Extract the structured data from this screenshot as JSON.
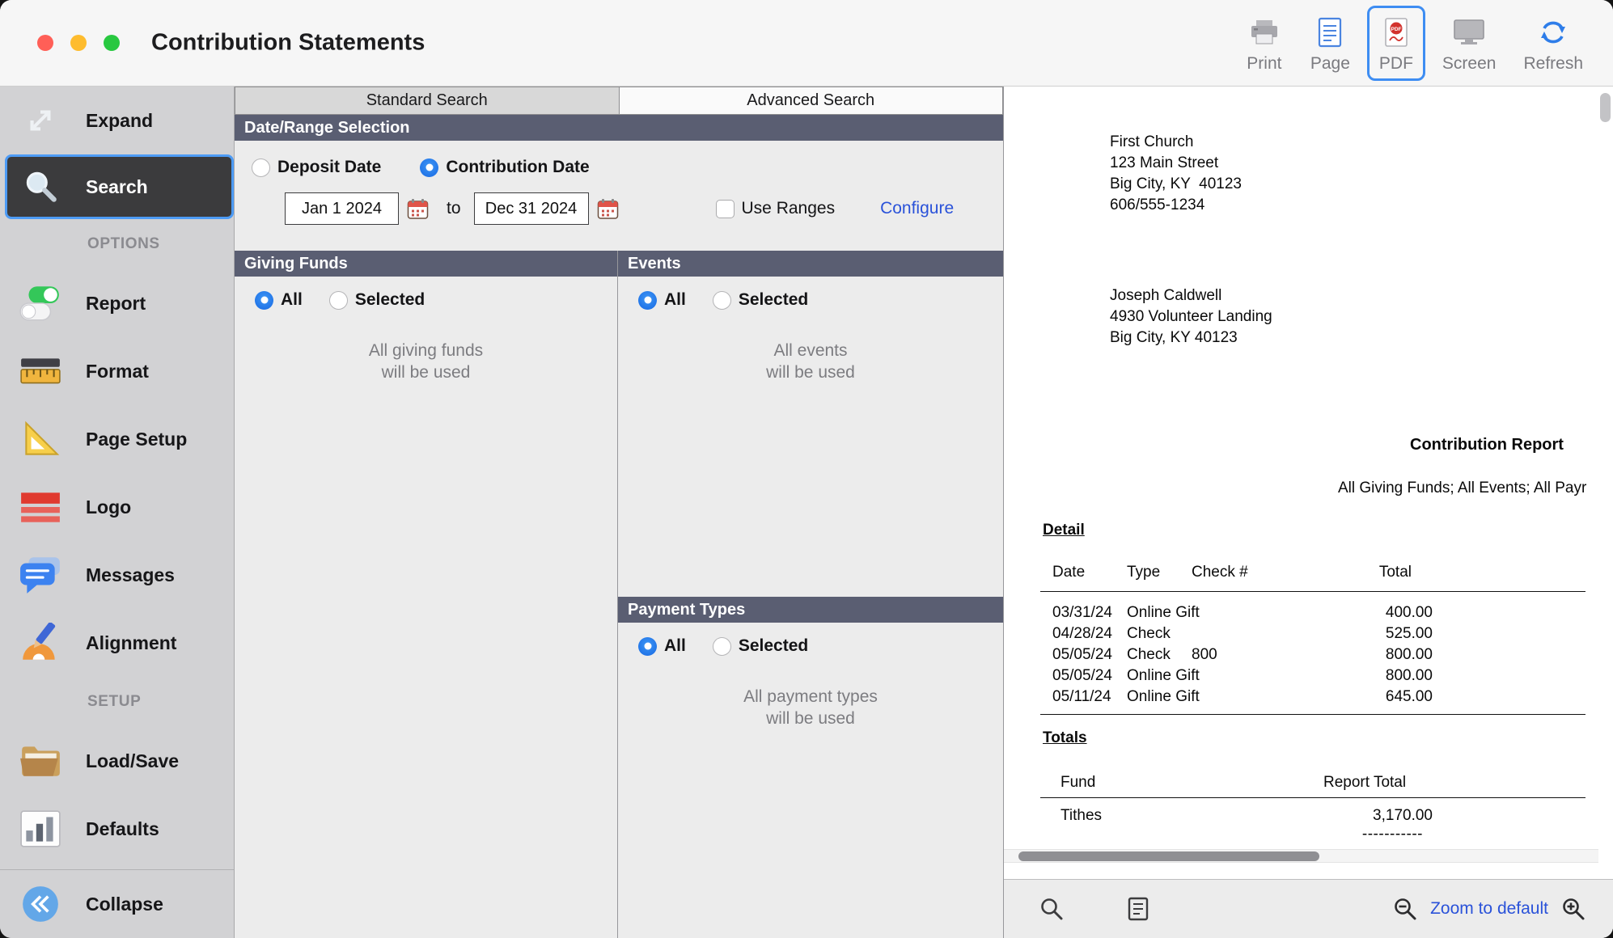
{
  "window": {
    "title": "Contribution Statements"
  },
  "toolbar": {
    "print": "Print",
    "page": "Page",
    "pdf": "PDF",
    "screen": "Screen",
    "refresh": "Refresh"
  },
  "sidebar": {
    "expand": "Expand",
    "search": "Search",
    "options_header": "OPTIONS",
    "report": "Report",
    "format": "Format",
    "page_setup": "Page Setup",
    "logo": "Logo",
    "messages": "Messages",
    "alignment": "Alignment",
    "setup_header": "SETUP",
    "load_save": "Load/Save",
    "defaults": "Defaults",
    "collapse": "Collapse"
  },
  "tabs": {
    "standard": "Standard Search",
    "advanced": "Advanced Search"
  },
  "date_range": {
    "header": "Date/Range Selection",
    "deposit_date": "Deposit Date",
    "contribution_date": "Contribution Date",
    "from_date": "Jan 1 2024",
    "to": "to",
    "to_date": "Dec 31 2024",
    "use_ranges": "Use Ranges",
    "configure": "Configure"
  },
  "giving_funds": {
    "header": "Giving Funds",
    "all": "All",
    "selected": "Selected",
    "note1": "All giving funds",
    "note2": "will be used"
  },
  "events": {
    "header": "Events",
    "all": "All",
    "selected": "Selected",
    "note1": "All events",
    "note2": "will be used"
  },
  "payment_types": {
    "header": "Payment Types",
    "all": "All",
    "selected": "Selected",
    "note1": "All payment types",
    "note2": "will be used"
  },
  "preview": {
    "church_name": "First Church",
    "church_street": "123 Main Street",
    "church_city": "Big City, KY  40123",
    "church_phone": "606/555-1234",
    "recipient_name": "Joseph Caldwell",
    "recipient_street": "4930 Volunteer Landing",
    "recipient_city": "Big City, KY 40123",
    "report_title": "Contribution Report",
    "report_subtitle": "All Giving Funds; All Events; All Payr",
    "detail_label": "Detail",
    "detail_columns": {
      "date": "Date",
      "type": "Type",
      "check": "Check #",
      "total": "Total"
    },
    "detail_rows": [
      {
        "date": "03/31/24",
        "type": "Online Gift",
        "check": "",
        "total": "400.00"
      },
      {
        "date": "04/28/24",
        "type": "Check",
        "check": "",
        "total": "525.00"
      },
      {
        "date": "05/05/24",
        "type": "Check",
        "check": "800",
        "total": "800.00"
      },
      {
        "date": "05/05/24",
        "type": "Online Gift",
        "check": "",
        "total": "800.00"
      },
      {
        "date": "05/11/24",
        "type": "Online Gift",
        "check": "",
        "total": "645.00"
      }
    ],
    "totals_label": "Totals",
    "totals_columns": {
      "fund": "Fund",
      "total": "Report Total"
    },
    "totals_rows": [
      {
        "fund": "Tithes",
        "total": "3,170.00"
      }
    ],
    "totals_separator": "-----------"
  },
  "zoom_bar": {
    "zoom_to_default": "Zoom to default"
  },
  "state": {
    "active_sidebar_item": "Search",
    "active_toolbar_button": "PDF",
    "active_tab": "Standard Search",
    "date_mode": "Contribution Date",
    "use_ranges_checked": false,
    "giving_funds_mode": "All",
    "events_mode": "All",
    "payment_types_mode": "All"
  },
  "colors": {
    "accent_blue": "#1668e3",
    "selection_border": "#3e8df2",
    "section_header_bg": "#5a5e72",
    "link_blue": "#2a52d9",
    "sidebar_bg": "#d2d2d4",
    "selected_item_bg": "#3b3b3d"
  },
  "icons": {
    "toolbar": [
      "printer-icon",
      "page-icon",
      "pdf-icon",
      "screen-icon",
      "refresh-icon"
    ],
    "sidebar": [
      "expand-arrows-icon",
      "magnifier-icon",
      "toggles-icon",
      "ruler-icon",
      "triangle-icon",
      "logo-bars-icon",
      "speech-bubble-icon",
      "protractor-pencil-icon",
      "folder-icon",
      "bar-chart-icon",
      "collapse-chevrons-icon"
    ],
    "fields": [
      "calendar-icon"
    ],
    "zoom_bar": [
      "find-icon",
      "page-view-icon",
      "zoom-out-icon",
      "zoom-in-icon"
    ]
  }
}
